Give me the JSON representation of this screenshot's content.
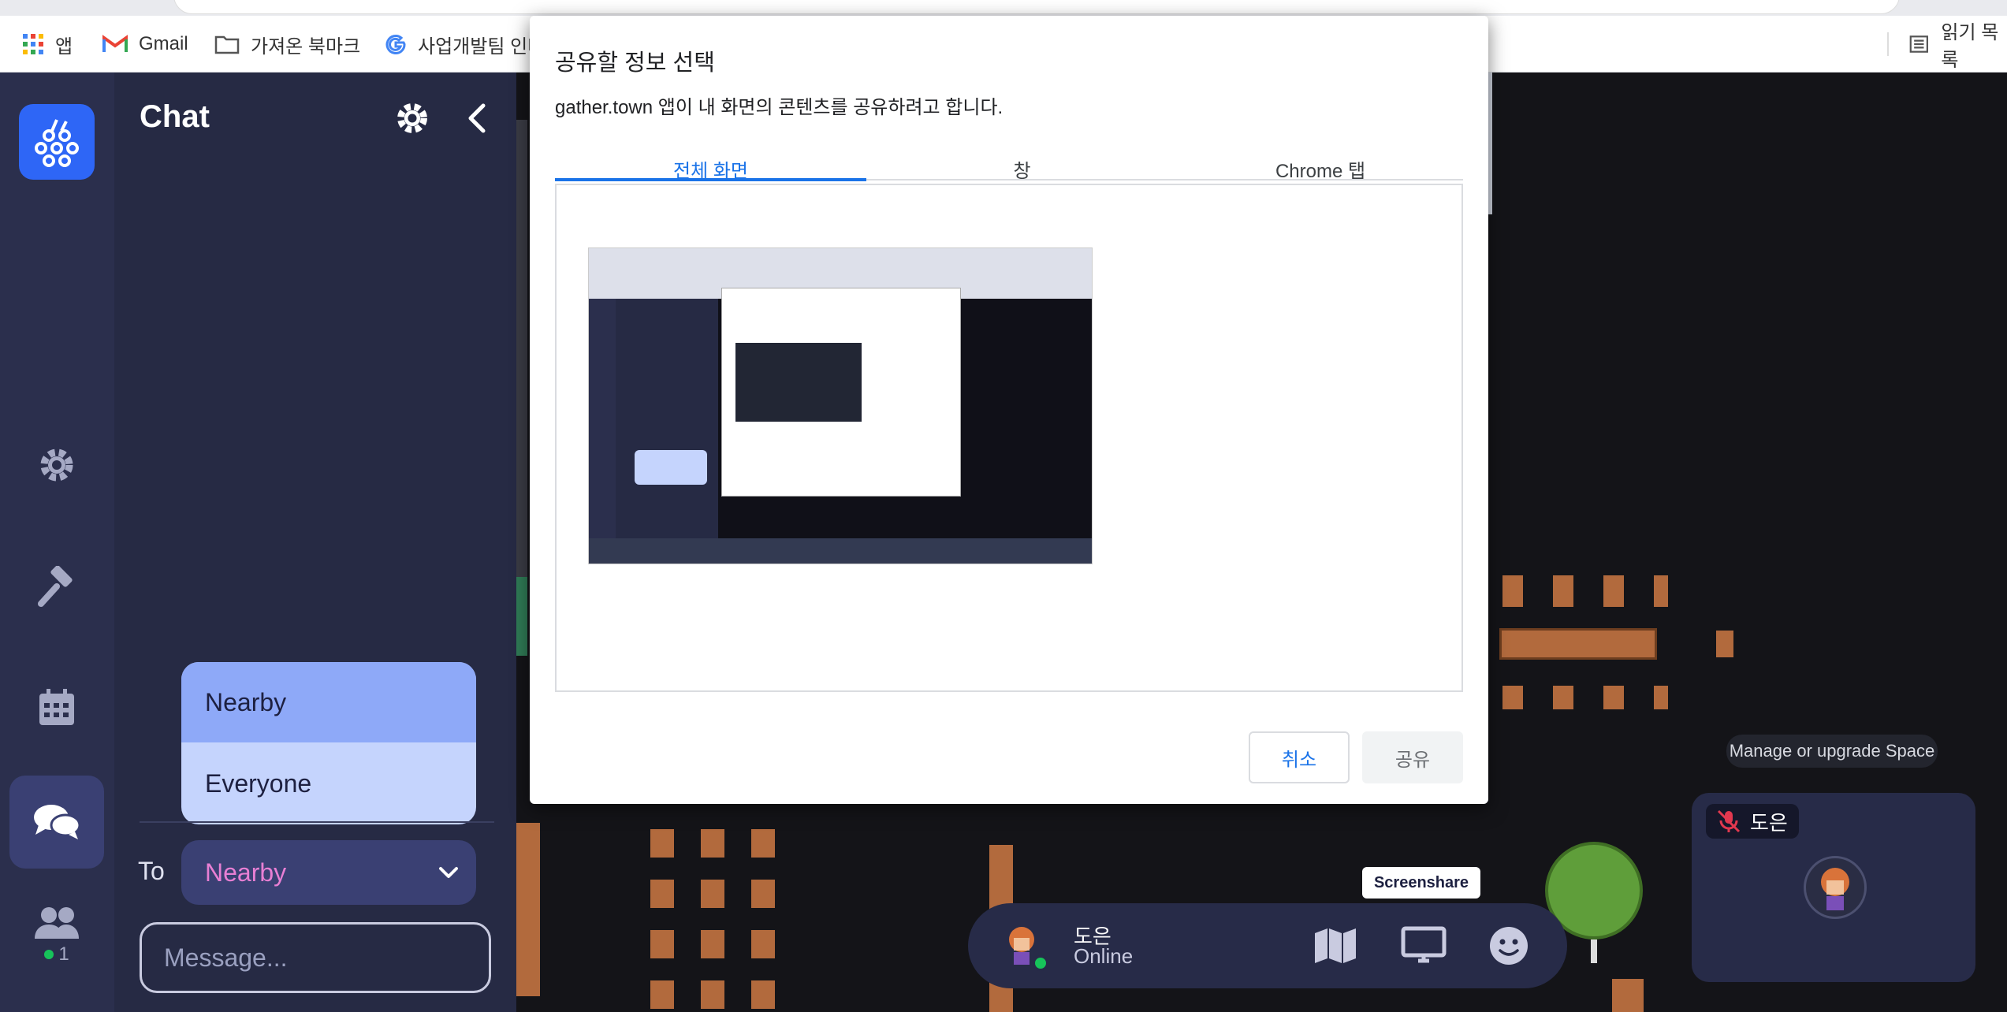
{
  "bookmarks": [
    {
      "label": "앱",
      "icon": "apps-grid-icon"
    },
    {
      "label": "Gmail",
      "icon": "gmail-icon"
    },
    {
      "label": "가져온 북마크",
      "icon": "folder-icon"
    },
    {
      "label": "사업개발팀 인터",
      "icon": "google-icon"
    }
  ],
  "reading_list": "읽기 목록",
  "chat_panel": {
    "title": "Chat",
    "audience_options": [
      "Nearby",
      "Everyone"
    ],
    "selected_audience": "Nearby",
    "to_label": "To",
    "message_placeholder": "Message...",
    "online_count": "1"
  },
  "share_dialog": {
    "title": "공유할 정보 선택",
    "subtitle": "gather.town 앱이 내 화면의 콘텐츠를 공유하려고 합니다.",
    "tabs": [
      "전체 화면",
      "창",
      "Chrome 탭"
    ],
    "active_tab": "전체 화면",
    "cancel_label": "취소",
    "share_label": "공유"
  },
  "manage_tooltip": "Manage or upgrade Space",
  "video_tile": {
    "name": "도은"
  },
  "screenshare_tooltip": "Screenshare",
  "bottom_bar": {
    "name": "도은",
    "status": "Online"
  },
  "colors": {
    "accent_blue": "#1a73e8",
    "gather_blue": "#2e66f6",
    "online_green": "#17c35a",
    "nearby_pink": "#e87fd4"
  }
}
